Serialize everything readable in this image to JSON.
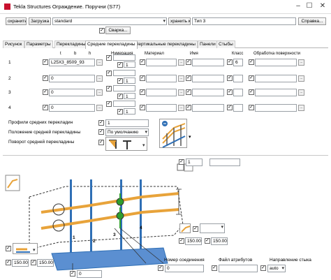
{
  "window": {
    "title": "Tekla Structures  Ограждение. Поручни (S77)"
  },
  "toolbar": {
    "save_label": "охранить",
    "load_label": "Загрузка",
    "preset_value": "standard",
    "save_as_label": "хранить к",
    "save_as_value": "Тип 3",
    "help_label": "Справка...",
    "weld_label": "Сварка..."
  },
  "tabs": [
    {
      "label": "Рисунок"
    },
    {
      "label": "Параметры"
    },
    {
      "label": "Перекладины"
    },
    {
      "label": "Средние перекладины"
    },
    {
      "label": "Вертикальные перекладины"
    },
    {
      "label": "Панели"
    },
    {
      "label": "Стыбы"
    }
  ],
  "active_tab": "Средние перекладины",
  "grid": {
    "headers": {
      "t": "t",
      "b": "b",
      "h": "h",
      "numbering": "Нумерация",
      "material": "Материал",
      "name": "Имя",
      "class": "Класс",
      "finish": "Обработка поверхности"
    },
    "rows": [
      {
        "label": "1",
        "profile": "L25X3_8509_93",
        "num_top": "",
        "num_bottom": "1",
        "material": "",
        "name": "",
        "class": "6",
        "finish": ""
      },
      {
        "label": "2",
        "profile": "0",
        "num_top": "",
        "num_bottom": "1",
        "material": "",
        "name": "",
        "class": "",
        "finish": ""
      },
      {
        "label": "3",
        "profile": "0",
        "num_top": "",
        "num_bottom": "1",
        "material": "",
        "name": "",
        "class": "",
        "finish": ""
      },
      {
        "label": "4",
        "profile": "0",
        "num_top": "",
        "num_bottom": "1",
        "material": "",
        "name": "",
        "class": "",
        "finish": ""
      }
    ]
  },
  "options": {
    "profiles_label": "Профили средних перекладин",
    "profiles_value": "1",
    "position_label": "Положение средней перекладины",
    "position_value": "По умолчанию",
    "rotation_label": "Поворот средней перекладины"
  },
  "diagram": {
    "top_value": "1",
    "numbers": [
      "1",
      "2",
      "3",
      "4"
    ],
    "right_value_1": "150.00",
    "right_value_2": "150.00",
    "left_value_1": "150.00",
    "left_value_2": "150.00",
    "bottom_left_value": "0",
    "connection_label": "Номер соединения",
    "connection_value": "0",
    "attr_file_label": "Файл атрибутов",
    "attr_file_value": "",
    "joint_dir_label": "Направление стыка",
    "joint_dir_value": "auto"
  },
  "colors": {
    "rail": "#e8a33a",
    "post": "#2f6fb5",
    "base": "#5b8fd1",
    "green": "#2e9e2e"
  }
}
